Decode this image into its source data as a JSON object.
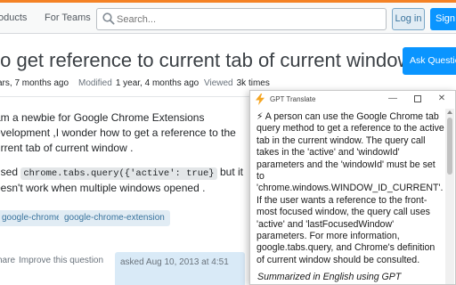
{
  "nav": {
    "products": "oducts",
    "for_teams": "For Teams",
    "search_placeholder": "Search...",
    "login": "Log in",
    "signup": "Sign"
  },
  "question": {
    "title": "to get reference to current tab of current window?",
    "ask_button": "Ask Question",
    "meta": {
      "asked_value": "ars, 7 months ago",
      "modified_label": "Modified",
      "modified_value": "1 year, 4 months ago",
      "viewed_label": "Viewed",
      "viewed_value": "3k times"
    },
    "body": {
      "line1": "am a newbie for Google Chrome Extensions",
      "line2": "evelopment ,I wonder how to get a reference to the",
      "line3": "urrent tab of current window .",
      "line4_pre": "used",
      "line4_code": "chrome.tabs.query({'active': true}",
      "line4_post": "but it",
      "line5": "oesn't work when multiple windows opened ."
    },
    "tags": [
      "google-chrome",
      "google-chrome-extension"
    ],
    "actions": {
      "share": "hare",
      "improve": "Improve this question"
    },
    "asked_box": "asked Aug 10, 2013 at 4:51"
  },
  "gpt_window": {
    "title": "GPT Translate",
    "icons": {
      "app": "lightning-icon",
      "minimize": "minimize-icon",
      "maximize": "maximize-icon",
      "close": "close-icon"
    },
    "summary": "⚡ A person can use the Google Chrome tab query method to get a reference to the active tab in the current window. The query call takes in the 'active' and 'windowId' parameters and the 'windowId' must be set to 'chrome.windows.WINDOW_ID_CURRENT'. If the user wants a reference to the front-most focused window, the query call uses 'active' and 'lastFocusedWindow' parameters. For more information, google.tabs.query, and Chrome's definition of current window should be consulted.",
    "footer": "Summarized in English using GPT"
  },
  "colors": {
    "accent": "#f48225",
    "primary_button": "#0a95ff",
    "tag_bg": "#e1ecf4",
    "tag_text": "#39739d"
  }
}
